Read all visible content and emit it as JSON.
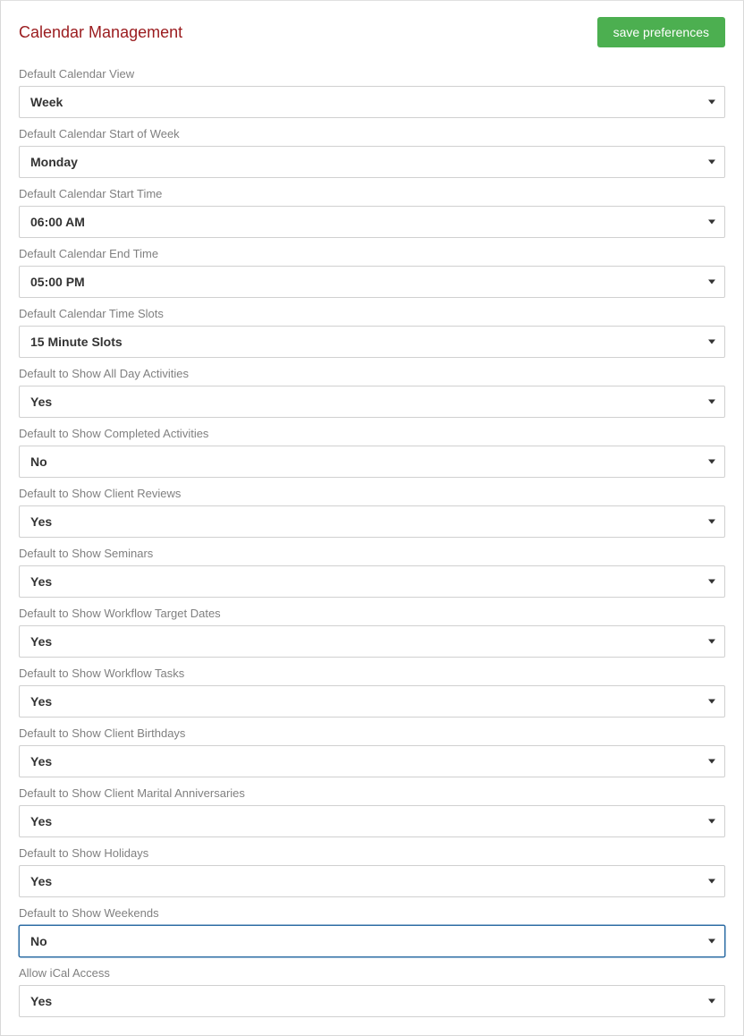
{
  "header": {
    "title": "Calendar Management",
    "save_label": "save preferences"
  },
  "fields": [
    {
      "key": "default-calendar-view",
      "label": "Default Calendar View",
      "value": "Week",
      "focused": false
    },
    {
      "key": "default-start-of-week",
      "label": "Default Calendar Start of Week",
      "value": "Monday",
      "focused": false
    },
    {
      "key": "default-start-time",
      "label": "Default Calendar Start Time",
      "value": "06:00 AM",
      "focused": false
    },
    {
      "key": "default-end-time",
      "label": "Default Calendar End Time",
      "value": "05:00 PM",
      "focused": false
    },
    {
      "key": "default-time-slots",
      "label": "Default Calendar Time Slots",
      "value": "15 Minute Slots",
      "focused": false
    },
    {
      "key": "show-all-day-activities",
      "label": "Default to Show All Day Activities",
      "value": "Yes",
      "focused": false
    },
    {
      "key": "show-completed-activities",
      "label": "Default to Show Completed Activities",
      "value": "No",
      "focused": false
    },
    {
      "key": "show-client-reviews",
      "label": "Default to Show Client Reviews",
      "value": "Yes",
      "focused": false
    },
    {
      "key": "show-seminars",
      "label": "Default to Show Seminars",
      "value": "Yes",
      "focused": false
    },
    {
      "key": "show-workflow-target-dates",
      "label": "Default to Show Workflow Target Dates",
      "value": "Yes",
      "focused": false
    },
    {
      "key": "show-workflow-tasks",
      "label": "Default to Show Workflow Tasks",
      "value": "Yes",
      "focused": false
    },
    {
      "key": "show-client-birthdays",
      "label": "Default to Show Client Birthdays",
      "value": "Yes",
      "focused": false
    },
    {
      "key": "show-marital-anniversaries",
      "label": "Default to Show Client Marital Anniversaries",
      "value": "Yes",
      "focused": false
    },
    {
      "key": "show-holidays",
      "label": "Default to Show Holidays",
      "value": "Yes",
      "focused": false
    },
    {
      "key": "show-weekends",
      "label": "Default to Show Weekends",
      "value": "No",
      "focused": true
    },
    {
      "key": "allow-ical-access",
      "label": "Allow iCal Access",
      "value": "Yes",
      "focused": false
    }
  ]
}
